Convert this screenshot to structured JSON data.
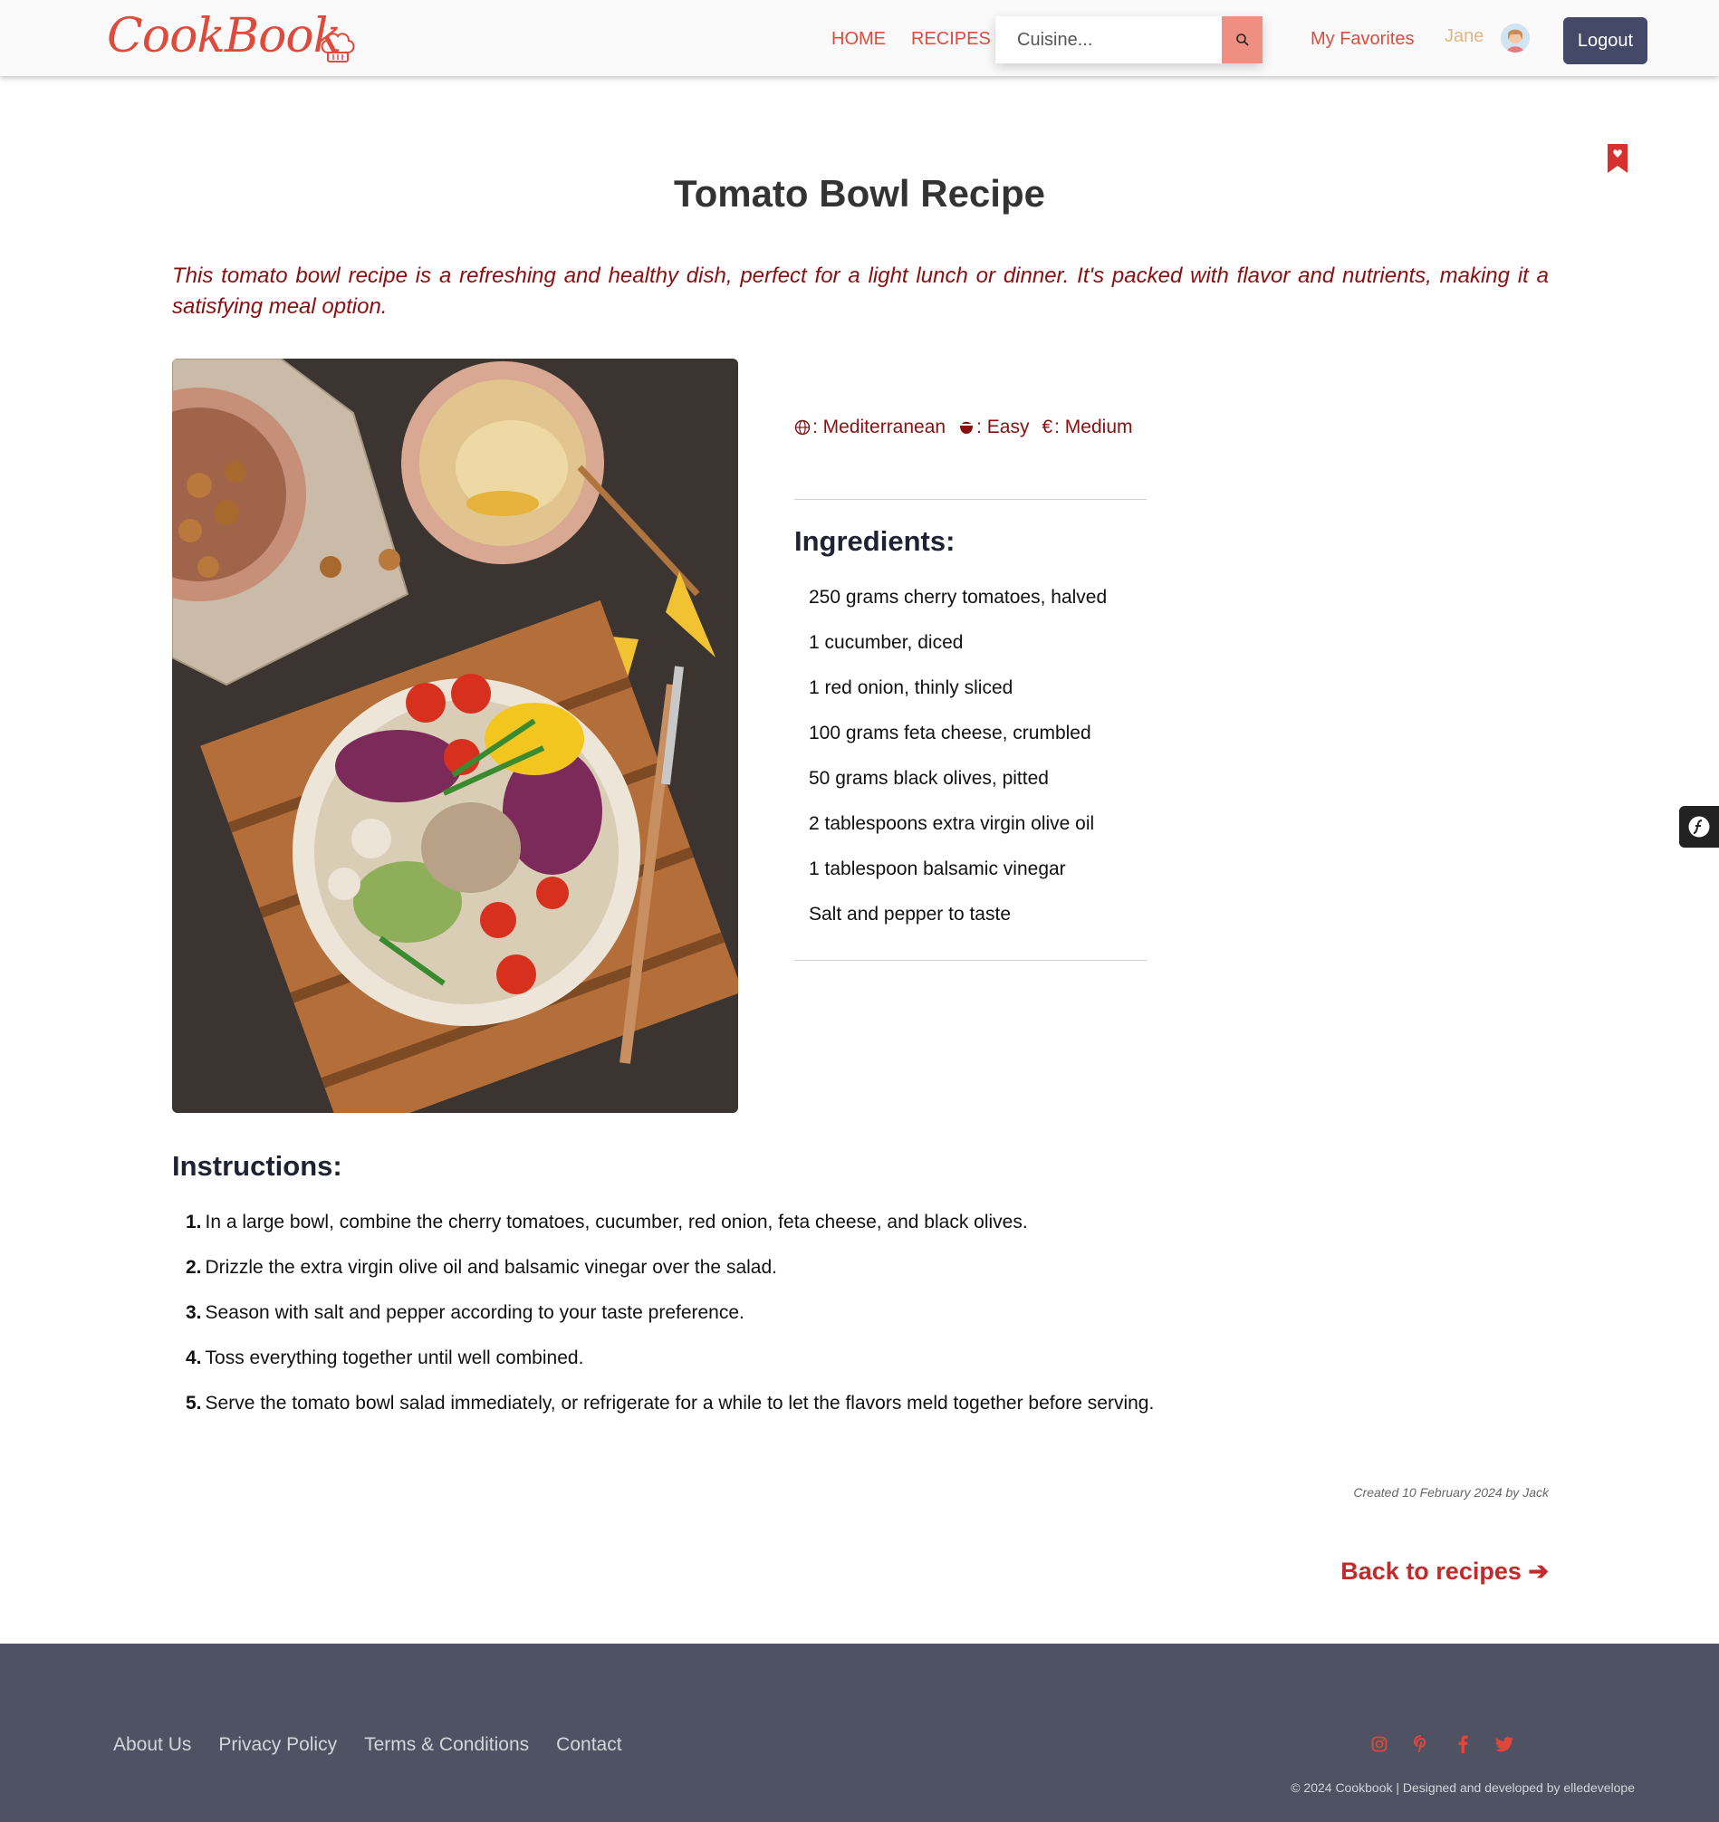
{
  "header": {
    "logo": "CookBook",
    "nav": {
      "home": "HOME",
      "recipes": "RECIPES"
    },
    "search": {
      "placeholder": "Cuisine..."
    },
    "favorites": "My Favorites",
    "user_name": "Jane",
    "logout": "Logout"
  },
  "recipe": {
    "title": "Tomato Bowl Recipe",
    "description": "This tomato bowl recipe is a refreshing and healthy dish, perfect for a light lunch or dinner. It's packed with flavor and nutrients, making it a satisfying meal option.",
    "meta": {
      "cuisine": ": Mediterranean",
      "difficulty": ": Easy",
      "price_symbol": "€",
      "price": ": Medium"
    },
    "ingredients_title": "Ingredients:",
    "ingredients": [
      "250 grams cherry tomatoes, halved",
      "1 cucumber, diced",
      "1 red onion, thinly sliced",
      "100 grams feta cheese, crumbled",
      "50 grams black olives, pitted",
      "2 tablespoons extra virgin olive oil",
      "1 tablespoon balsamic vinegar",
      "Salt and pepper to taste"
    ],
    "instructions_title": "Instructions:",
    "instructions": [
      {
        "num": "1.",
        "text": "In a large bowl, combine the cherry tomatoes, cucumber, red onion, feta cheese, and black olives."
      },
      {
        "num": "2.",
        "text": "Drizzle the extra virgin olive oil and balsamic vinegar over the salad."
      },
      {
        "num": "3.",
        "text": "Season with salt and pepper according to your taste preference."
      },
      {
        "num": "4.",
        "text": "Toss everything together until well combined."
      },
      {
        "num": "5.",
        "text": "Serve the tomato bowl salad immediately, or refrigerate for a while to let the flavors meld together before serving."
      }
    ],
    "created": "Created 10 February 2024 by Jack",
    "back_link": "Back to recipes ➔"
  },
  "footer": {
    "links": [
      "About Us",
      "Privacy Policy",
      "Terms & Conditions",
      "Contact"
    ],
    "socials": [
      "instagram-icon",
      "pinterest-icon",
      "facebook-icon",
      "twitter-icon"
    ],
    "copyright": "© 2024 Cookbook | Designed and developed by elledevelope"
  },
  "colors": {
    "accent": "#dd4b3c",
    "dark_red": "#8a0f0f",
    "logout_bg": "#434966",
    "footer_bg": "#4f5262"
  }
}
